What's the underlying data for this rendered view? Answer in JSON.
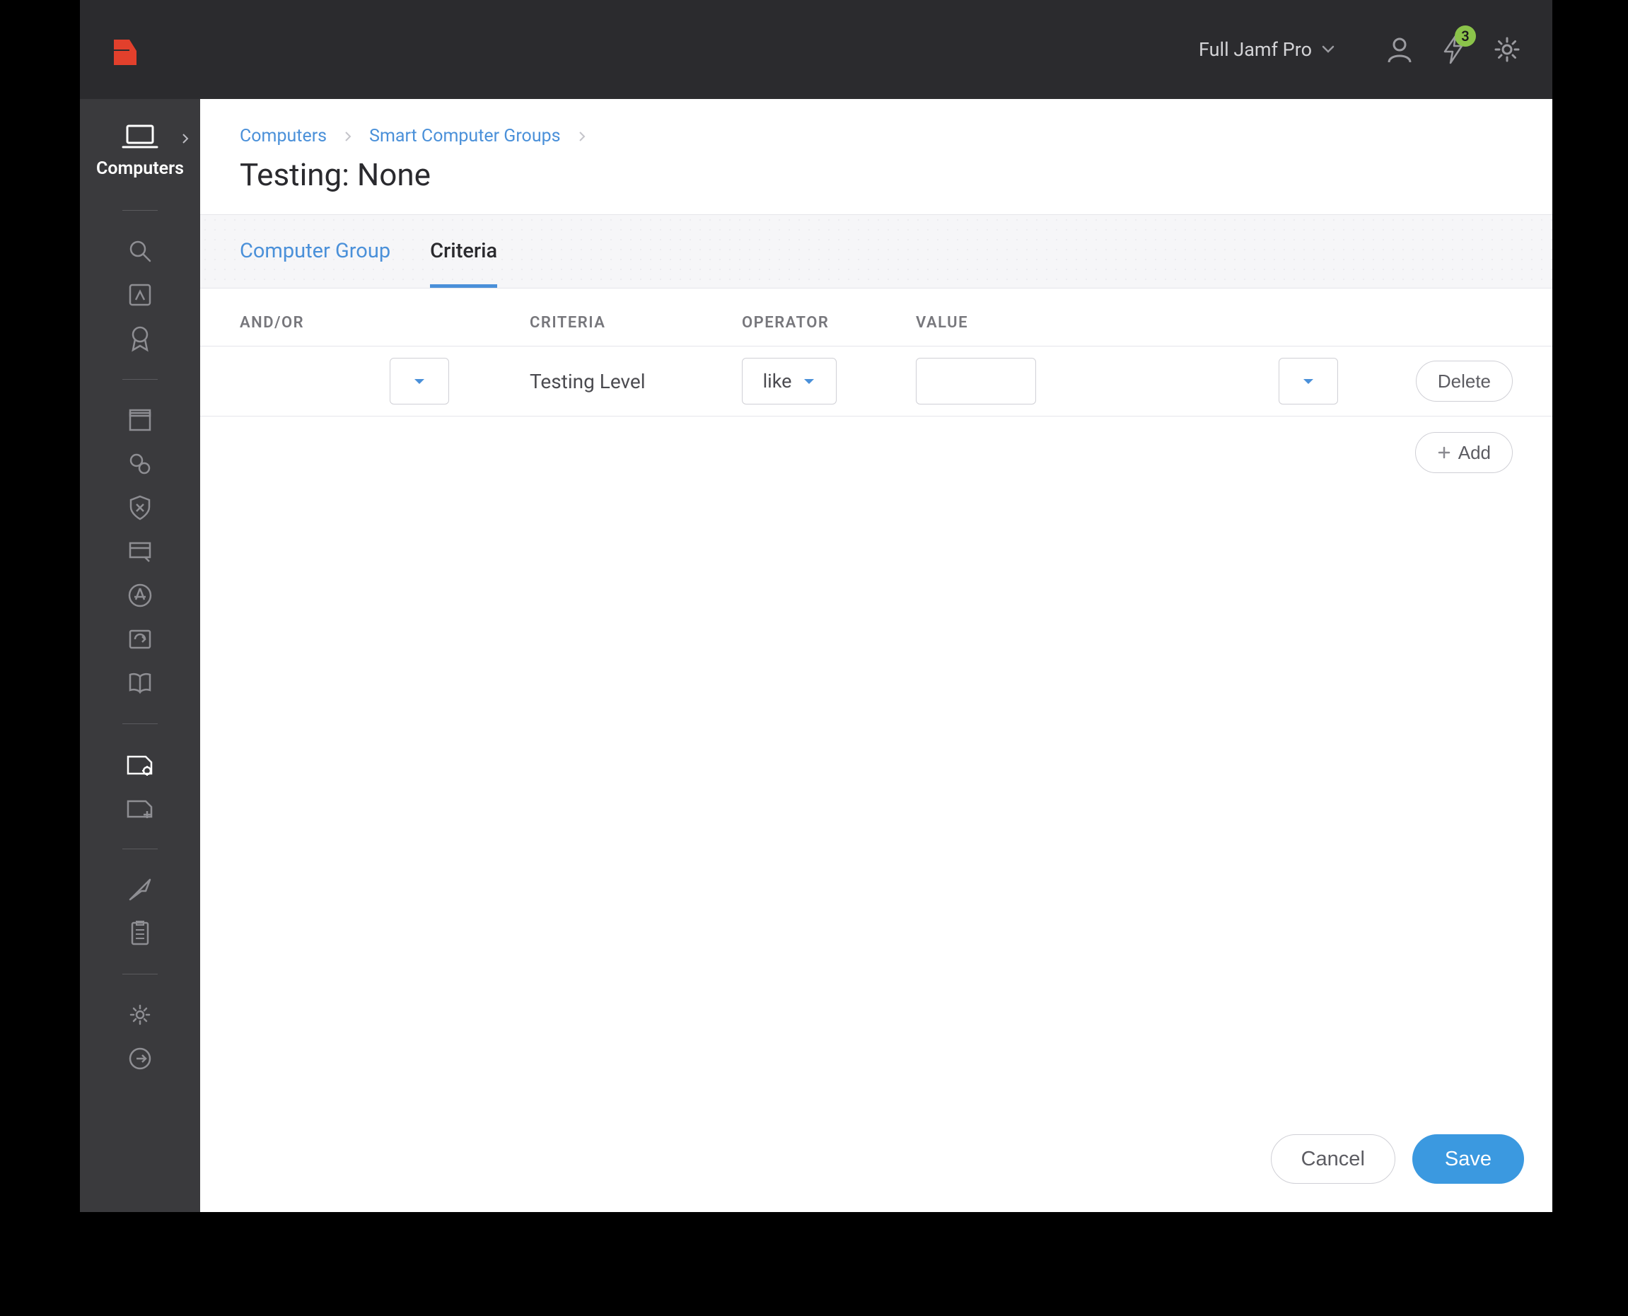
{
  "header": {
    "profile_label": "Full Jamf Pro",
    "notification_count": "3"
  },
  "sidebar": {
    "active_label": "Computers"
  },
  "breadcrumb": {
    "item1": "Computers",
    "item2": "Smart Computer Groups"
  },
  "page": {
    "title": "Testing: None"
  },
  "tabs": {
    "tab1": "Computer Group",
    "tab2": "Criteria"
  },
  "table": {
    "col_andor": "AND/OR",
    "col_criteria": "CRITERIA",
    "col_operator": "OPERATOR",
    "col_value": "VALUE"
  },
  "row": {
    "criteria_name": "Testing Level",
    "operator": "like",
    "value": "",
    "delete_label": "Delete"
  },
  "actions": {
    "add_label": "Add",
    "cancel_label": "Cancel",
    "save_label": "Save"
  }
}
